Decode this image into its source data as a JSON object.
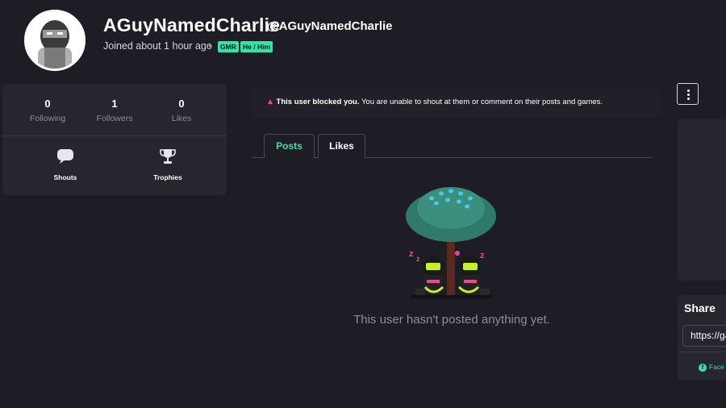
{
  "profile": {
    "username": "AGuyNamedCharlie",
    "handle": "@AGuyNamedCharlie",
    "joined": "Joined about 1 hour ago",
    "separator": "•",
    "tags": [
      "GMR",
      "He / Him"
    ],
    "avatar_icon": "ninja-avatar"
  },
  "stats": {
    "following": {
      "value": "0",
      "label": "Following"
    },
    "followers": {
      "value": "1",
      "label": "Followers"
    },
    "likes": {
      "value": "0",
      "label": "Likes"
    }
  },
  "tools": {
    "shouts": {
      "label": "Shouts",
      "icon": "speech-bubble-icon"
    },
    "trophies": {
      "label": "Trophies",
      "icon": "trophy-icon"
    }
  },
  "banner": {
    "icon": "warning-icon",
    "bold": "This user blocked you.",
    "text": "You are unable to shout at them or comment on their posts and games."
  },
  "tabs": {
    "posts": "Posts",
    "likes": "Likes",
    "active": "Posts"
  },
  "empty_state": {
    "message": "This user hasn't posted anything yet."
  },
  "share": {
    "title": "Share",
    "url": "https://ga",
    "facebook": "Face"
  },
  "colors": {
    "background": "#1e1c24",
    "card": "#27252e",
    "accent": "#2fe6a8",
    "warning": "#ff3d9a",
    "muted": "#8f8c98"
  }
}
